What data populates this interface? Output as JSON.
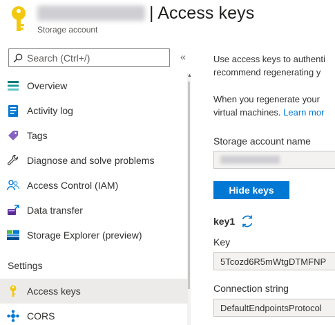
{
  "header": {
    "title": "| Access keys",
    "subtitle": "Storage account"
  },
  "sidebar": {
    "search_placeholder": "Search (Ctrl+/)",
    "collapse_glyph": "«",
    "items": [
      {
        "label": "Overview",
        "icon": "overview-icon"
      },
      {
        "label": "Activity log",
        "icon": "activity-log-icon"
      },
      {
        "label": "Tags",
        "icon": "tag-icon"
      },
      {
        "label": "Diagnose and solve problems",
        "icon": "wrench-icon"
      },
      {
        "label": "Access Control (IAM)",
        "icon": "people-icon"
      },
      {
        "label": "Data transfer",
        "icon": "data-transfer-icon"
      },
      {
        "label": "Storage Explorer (preview)",
        "icon": "storage-explorer-icon"
      }
    ],
    "section_settings": "Settings",
    "settings_items": [
      {
        "label": "Access keys",
        "icon": "key-icon",
        "selected": true
      },
      {
        "label": "CORS",
        "icon": "cors-icon"
      }
    ]
  },
  "main": {
    "para1_line1": "Use access keys to authenti",
    "para1_line2": "recommend regenerating y",
    "para2_line1": "When you regenerate your",
    "para2_line2_text": "virtual machines. ",
    "para2_line2_link": "Learn mor",
    "storage_account_label": "Storage account name",
    "hide_keys_button": "Hide keys",
    "key1_heading": "key1",
    "key_label": "Key",
    "key_value": "5Tcozd6R5mWtgDTMFNP",
    "connection_string_label": "Connection string",
    "connection_string_value": "DefaultEndpointsProtocol"
  },
  "colors": {
    "accent": "#0078d4",
    "key_gold": "#f2c811",
    "selected_bg": "#edebe9"
  }
}
